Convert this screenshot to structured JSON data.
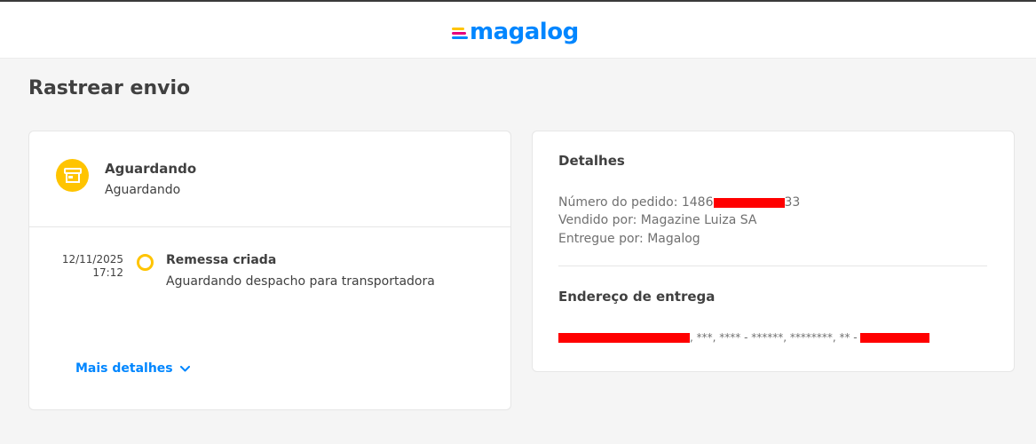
{
  "header": {
    "logo_text": "magalog",
    "logo_line_colors": [
      "#ffc400",
      "#e5007d",
      "#0086ff"
    ],
    "logo_color": "#0086ff"
  },
  "page": {
    "title": "Rastrear envio"
  },
  "status": {
    "icon": "store-icon",
    "icon_bg": "#ffc400",
    "title": "Aguardando",
    "subtitle": "Aguardando"
  },
  "timeline": {
    "events": [
      {
        "date": "12/11/2025",
        "time": "17:12",
        "title": "Remessa criada",
        "description": "Aguardando despacho para transportadora",
        "dot_color": "#ffc400"
      }
    ]
  },
  "more_details": {
    "label": "Mais detalhes",
    "icon": "chevron-down-icon",
    "color": "#0086ff"
  },
  "details": {
    "title": "Detalhes",
    "order_number_prefix": "Número do pedido: 1486",
    "order_number_suffix": "33",
    "sold_by": "Vendido por: Magazine Luiza SA",
    "delivered_by": "Entregue por: Magalog"
  },
  "address": {
    "title": "Endereço de entrega",
    "masked_text": ", ***, **** - ******, ********, ** - "
  },
  "colors": {
    "redaction": "#ff0000",
    "accent": "#0086ff",
    "status": "#ffc400"
  }
}
